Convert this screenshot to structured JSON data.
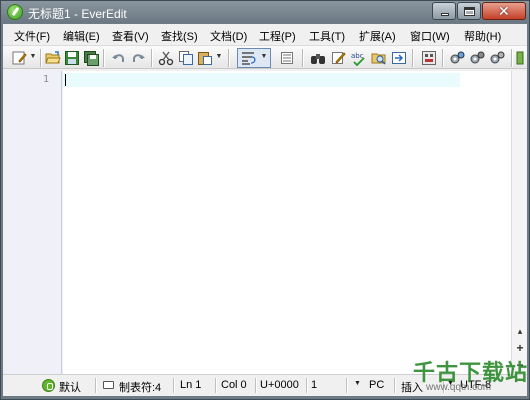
{
  "window": {
    "title": "无标题1 - EverEdit",
    "controls": {
      "minimize": "minimize",
      "maximize": "maximize",
      "close": "✕"
    }
  },
  "menu": [
    "文件(F)",
    "编辑(E)",
    "查看(V)",
    "查找(S)",
    "文档(D)",
    "工程(P)",
    "工具(T)",
    "扩展(A)",
    "窗口(W)",
    "帮助(H)"
  ],
  "toolbar": {
    "icons": [
      "new-file-icon",
      "open-folder-icon",
      "save-icon",
      "save-all-icon",
      "undo-icon",
      "redo-icon",
      "cut-icon",
      "copy-icon",
      "paste-icon",
      "word-wrap-icon",
      "column-mode-icon",
      "find-icon",
      "replace-icon",
      "spell-check-icon",
      "find-in-files-icon",
      "goto-icon",
      "macro-record-icon",
      "plugin-icon",
      "settings-icon",
      "tools-icon"
    ]
  },
  "editor": {
    "line_numbers": [
      "1"
    ],
    "content": "",
    "current_line_color": "#eafbfd",
    "gutter_color": "#f0f0f8"
  },
  "zoom": {
    "in": "+",
    "out": "−"
  },
  "statusbar": {
    "spell": "默认",
    "tab": "制表符:4",
    "line": "Ln 1",
    "col": "Col 0",
    "char": "U+0000",
    "sel": "1",
    "eol": "PC",
    "insert": "插入",
    "encoding": "UTF-8"
  },
  "watermark": {
    "logo": "千古下载站",
    "url": "www.qqtn.com"
  },
  "colors": {
    "titlebar": "#7a8690",
    "accent_green": "#5fb62c",
    "watermark_green": "#2f8c2f"
  }
}
